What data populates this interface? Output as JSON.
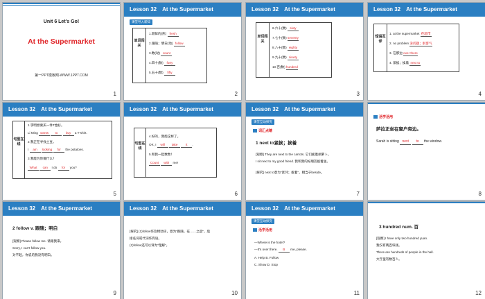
{
  "slides": [
    {
      "num": "1",
      "unit": "Unit 6  Let's Go!",
      "title": "At the Supermarket",
      "credit": "第一PPT模板网-WWW.1PPT.COM"
    },
    {
      "num": "2",
      "header": "Lesson  32",
      "subtitle": "At the Supermarket",
      "tag": "课堂导入新知",
      "label": "单词闯关",
      "lines": [
        "1.新鲜的(形)",
        "2.跟随；明白(动)",
        "3.数(动)",
        "4.四十(数)",
        "5.五十(数)"
      ],
      "answers": [
        "fresh",
        "follow",
        "count",
        "forty",
        "fifty"
      ]
    },
    {
      "num": "3",
      "header": "Lesson  32",
      "subtitle": "At the Supermarket",
      "label": "单词闯关",
      "lines": [
        "6.六十(数)",
        "7.七十(数)",
        "8.八十(数)",
        "9.九十(数)",
        "10.百(数)"
      ],
      "answers": [
        "sixty",
        "seventy",
        "eighty",
        "ninety",
        "hundred"
      ]
    },
    {
      "num": "4",
      "header": "Lesson  32",
      "subtitle": "At the Supermarket",
      "label": "短语互译",
      "lines": [
        "1. at the supermarket",
        "2. no problem",
        "3. 在那边",
        "4. 紧挨；挨着"
      ],
      "answers": [
        "在超市",
        "没问题；别客气",
        "over there",
        "next to"
      ]
    },
    {
      "num": "5",
      "header": "Lesson  32",
      "subtitle": "At the Supermarket",
      "label": "句型在线",
      "lines": [
        "1.李明想要买一件T恤衫。",
        "Li Ming ____ ____ ____ a T-shirt.",
        "2.我正在寻找土豆。",
        "I ____ ____ ____ the potatoes.",
        "3.我能为你做什么？",
        "____ ____ I do ____ you?"
      ],
      "answers": [
        "wants",
        "to",
        "buy",
        "am",
        "looking",
        "for",
        "What",
        "can",
        "for"
      ]
    },
    {
      "num": "6",
      "header": "Lesson  32",
      "subtitle": "At the Supermarket",
      "label": "句型在线",
      "lines": [
        "4.好的，我能这样了。",
        "OK, I ____ ____ ____.",
        "5.和我一起数数！",
        "____ ____ me!"
      ],
      "answers": [
        "will",
        "take",
        "it",
        "Count",
        "with"
      ]
    },
    {
      "num": "7",
      "header": "Lesson  32",
      "subtitle": "At the Supermarket",
      "tag": "课堂互动探究",
      "sec": "词汇点睛",
      "point": "1  next to紧挨；挨着",
      "lines": [
        "[观察] They are next to the carrots. 它们挨着胡萝卜。",
        "I sit next to my good friend. 我和我的好朋友挨着坐。",
        "[探究] next to意为“紧邻；挨着”，相当于beside。"
      ]
    },
    {
      "num": "8",
      "sec": "活学活用",
      "q": "萨拉正坐在窗户旁边。",
      "line": "Sarah is sitting ____ ____ the window.",
      "answers": [
        "next",
        "to"
      ]
    },
    {
      "num": "9",
      "header": "Lesson  32",
      "subtitle": "At the Supermarket",
      "point": "2  follow v. 跟随；明白",
      "lines": [
        "[观察] Please follow me. 请跟我来。",
        "Sorry, I can't follow you.",
        "对不起，你说的我没有明白。"
      ]
    },
    {
      "num": "10",
      "header": "Lesson  32",
      "subtitle": "At the Supermarket",
      "lines": [
        "[探究] (1)follow作及物动词，意为“跟随，在……之后”，后",
        "接名词或代词作宾语。",
        "(2)follow还可以译为“理解”。"
      ]
    },
    {
      "num": "11",
      "header": "Lesson  32",
      "subtitle": "At the Supermarket",
      "tag": "课堂互动探究",
      "sec": "活学活用",
      "lines": [
        "—Where is the hotel?",
        "—It's over there. ____ me, please.",
        "A. Help        B. Follow",
        "C. Show        D. Stop"
      ],
      "answers": [
        "B"
      ]
    },
    {
      "num": "12",
      "point": "3  hundred num. 百",
      "lines": [
        "[观察] I have only two hundred yuan.",
        "我仅有两百块钱。",
        "There are hundreds of people in the hall.",
        "大厅里有数百人。"
      ]
    }
  ]
}
